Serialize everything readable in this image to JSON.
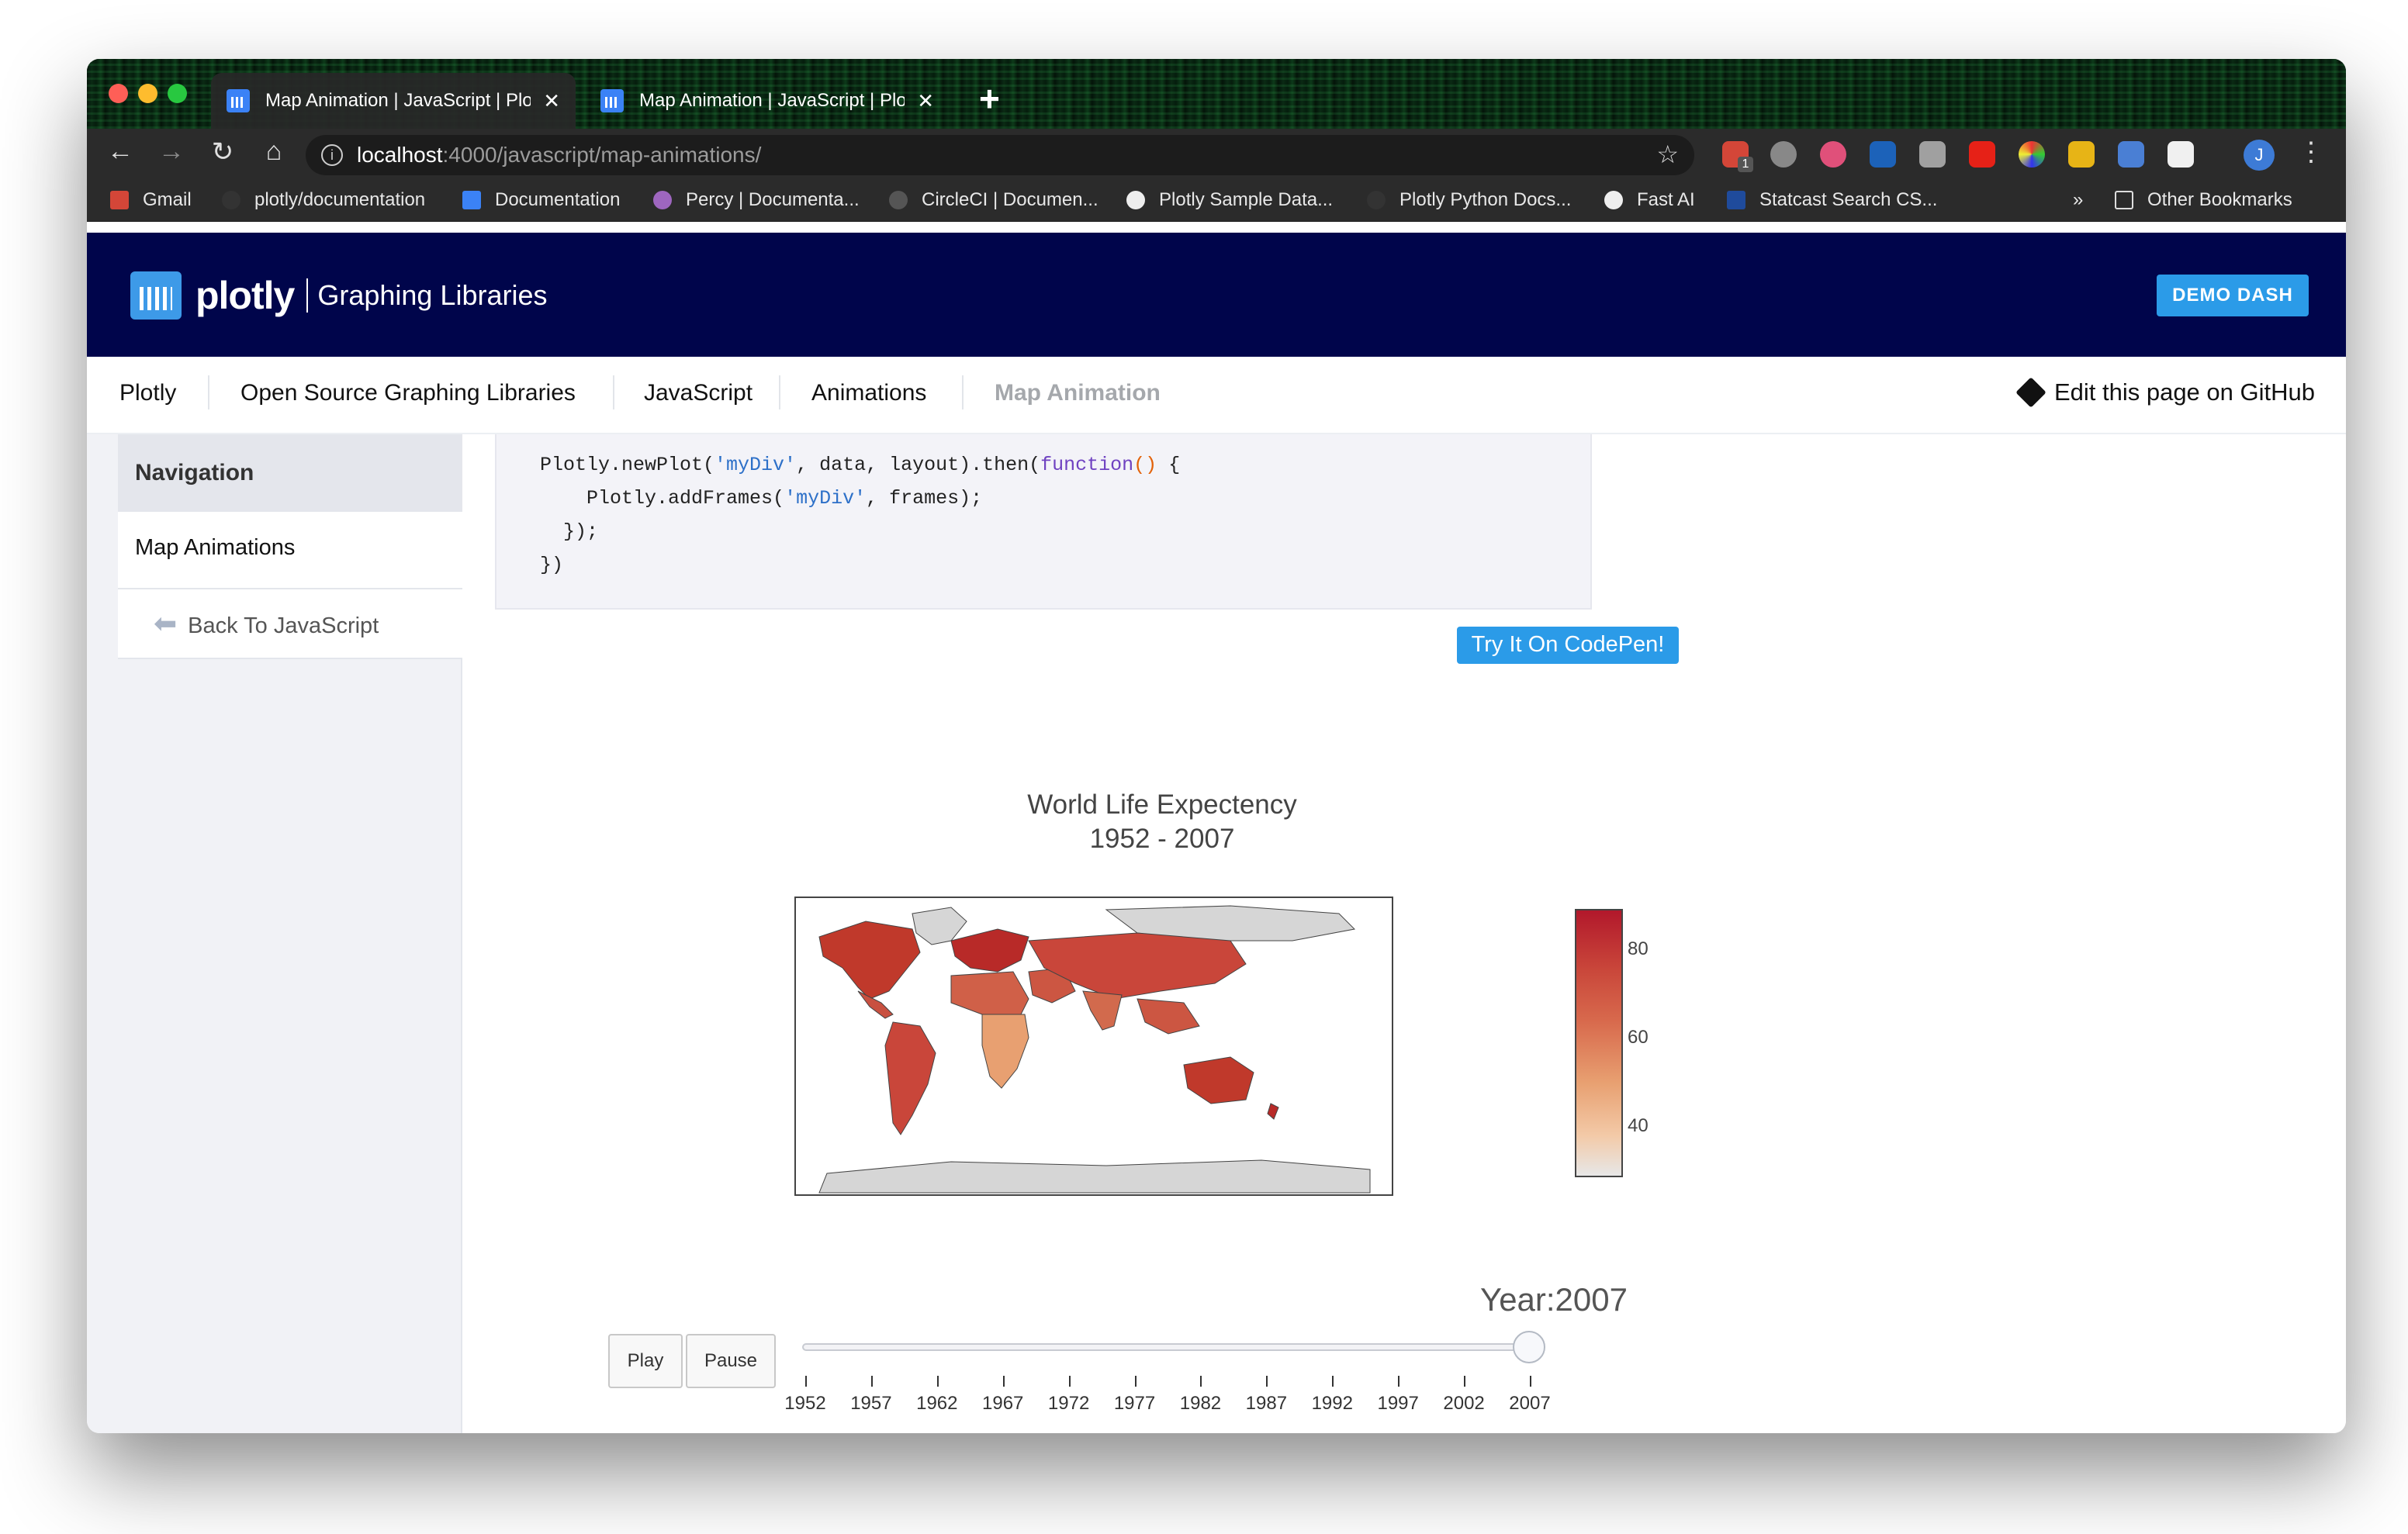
{
  "browser": {
    "tabs": [
      {
        "title": "Map Animation | JavaScript | Plo",
        "close": "✕"
      },
      {
        "title": "Map Animation | JavaScript | Plo",
        "close": "✕"
      }
    ],
    "new_tab": "+",
    "url_host": "localhost",
    "url_path": ":4000/javascript/map-animations/",
    "bookmarks": [
      "Gmail",
      "plotly/documentation",
      "Documentation",
      "Percy | Documenta...",
      "CircleCI | Documen...",
      "Plotly Sample Data...",
      "Plotly Python Docs...",
      "Fast AI",
      "Statcast Search CS...",
      "Other Bookmarks"
    ],
    "bookmarks_overflow": "»",
    "avatar_letter": "J",
    "ext_badge": "1"
  },
  "site": {
    "brand": "plotly",
    "tagline": "Graphing Libraries",
    "demo_button": "DEMO DASH"
  },
  "breadcrumb": {
    "items": [
      "Plotly",
      "Open Source Graphing Libraries",
      "JavaScript",
      "Animations",
      "Map Animation"
    ],
    "edit_link": "Edit this page on GitHub"
  },
  "sidebar": {
    "heading": "Navigation",
    "item": "Map Animations",
    "back": "Back To JavaScript"
  },
  "code": {
    "line1_a": "Plotly.newPlot(",
    "line1_str": "'myDiv'",
    "line1_b": ", data, layout).then(",
    "line1_kw": "function",
    "line1_paren": "()",
    "line1_c": " {",
    "line2_a": "    Plotly.addFrames(",
    "line2_str": "'myDiv'",
    "line2_b": ", frames);",
    "line3": "  });",
    "line4": "})"
  },
  "codepen_button": "Try It On CodePen!",
  "chart": {
    "title_line1": "World Life Expectency",
    "title_line2": "1952 - 2007",
    "colorbar_ticks": [
      "80",
      "60",
      "40"
    ],
    "current_year_label": "Year:2007",
    "play": "Play",
    "pause": "Pause",
    "slider_years": [
      "1952",
      "1957",
      "1962",
      "1967",
      "1972",
      "1977",
      "1982",
      "1987",
      "1992",
      "1997",
      "2002",
      "2007"
    ],
    "slider_value": "2007"
  },
  "colors": {
    "header_bg": "#00054b",
    "accent": "#2b9be8",
    "colorscale_high": "#b2182b",
    "colorscale_low": "#e7e7e7"
  }
}
